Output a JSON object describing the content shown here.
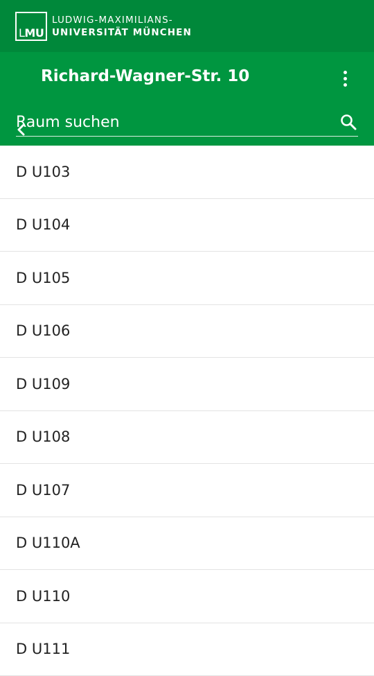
{
  "brand": {
    "logo_text": "LMU",
    "line1": "LUDWIG-MAXIMILIANS-",
    "line2": "UNIVERSITÄT MÜNCHEN",
    "bar_color": "#00883a"
  },
  "appbar": {
    "title": "Richard-Wagner-Str. 10",
    "color": "#009640",
    "back_icon": "chevron-left-icon",
    "menu_icon": "more-vert-icon"
  },
  "search": {
    "placeholder": "Raum suchen",
    "value": "",
    "icon": "search-icon"
  },
  "rooms": [
    {
      "label": "D U103"
    },
    {
      "label": "D U104"
    },
    {
      "label": "D U105"
    },
    {
      "label": "D U106"
    },
    {
      "label": "D U109"
    },
    {
      "label": "D U108"
    },
    {
      "label": "D U107"
    },
    {
      "label": "D U110A"
    },
    {
      "label": "D U110"
    },
    {
      "label": "D U111"
    }
  ]
}
